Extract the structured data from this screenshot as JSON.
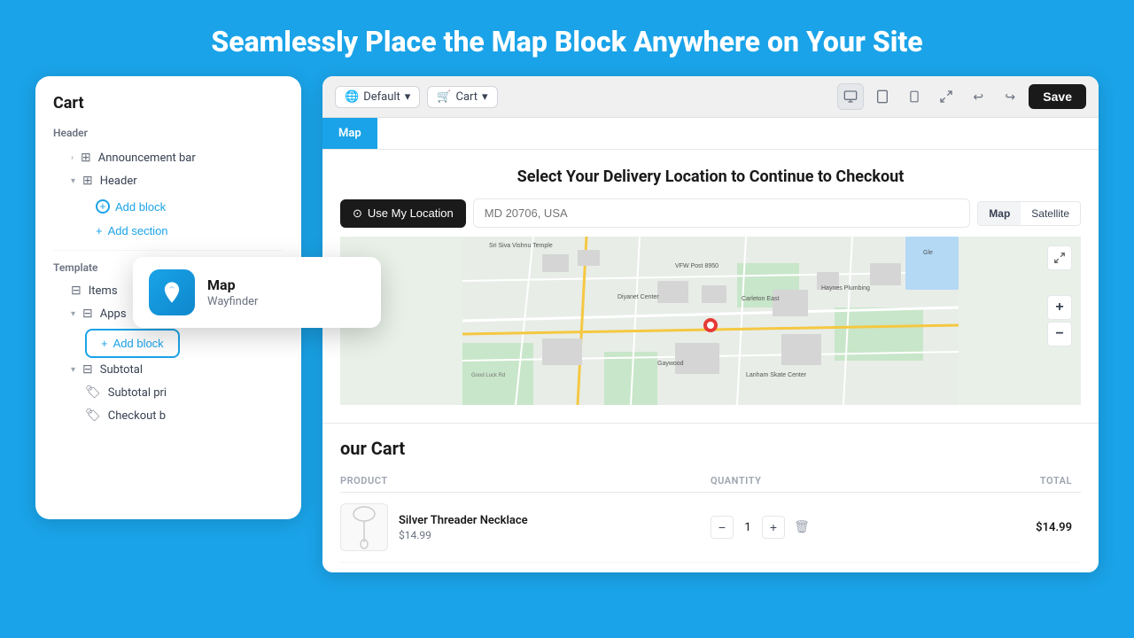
{
  "page": {
    "title": "Seamlessly Place the Map Block Anywhere on Your Site",
    "background_color": "#1aa3e8"
  },
  "cart_panel": {
    "title": "Cart",
    "sections": {
      "header_label": "Header",
      "announcement_bar": "Announcement bar",
      "header": "Header",
      "add_block": "Add block",
      "add_section": "Add section",
      "template_label": "Template",
      "items": "Items",
      "apps": "Apps",
      "apps_add_block": "Add block",
      "subtotal": "Subtotal",
      "subtotal_price": "Subtotal pri",
      "checkout_btn": "Checkout b"
    }
  },
  "tooltip": {
    "title": "Map",
    "subtitle": "Wayfinder"
  },
  "browser": {
    "dropdown_default": "Default",
    "dropdown_cart": "Cart",
    "save_label": "Save"
  },
  "map_block": {
    "tab": "Map",
    "title": "Select Your Delivery Location to Continue to Checkout",
    "use_location_btn": "Use My Location",
    "address_placeholder": "MD 20706, USA",
    "map_btn": "Map",
    "satellite_btn": "Satellite",
    "zoom_in": "+",
    "zoom_out": "−"
  },
  "cart_section": {
    "title": "our Cart",
    "columns": {
      "product": "PRODUCT",
      "quantity": "QUANTITY",
      "total": "TOTAL"
    },
    "items": [
      {
        "name": "Silver Threader Necklace",
        "price": "$14.99",
        "quantity": 1,
        "total": "$14.99"
      }
    ]
  },
  "icons": {
    "globe": "🌐",
    "cart": "🛒",
    "chevron_down": "▾",
    "desktop": "🖥",
    "tablet": "📱",
    "mobile": "📱",
    "expand": "⤢",
    "undo": "↩",
    "redo": "↪",
    "location_pin": "📍",
    "delete": "🗑",
    "target": "⊙"
  }
}
